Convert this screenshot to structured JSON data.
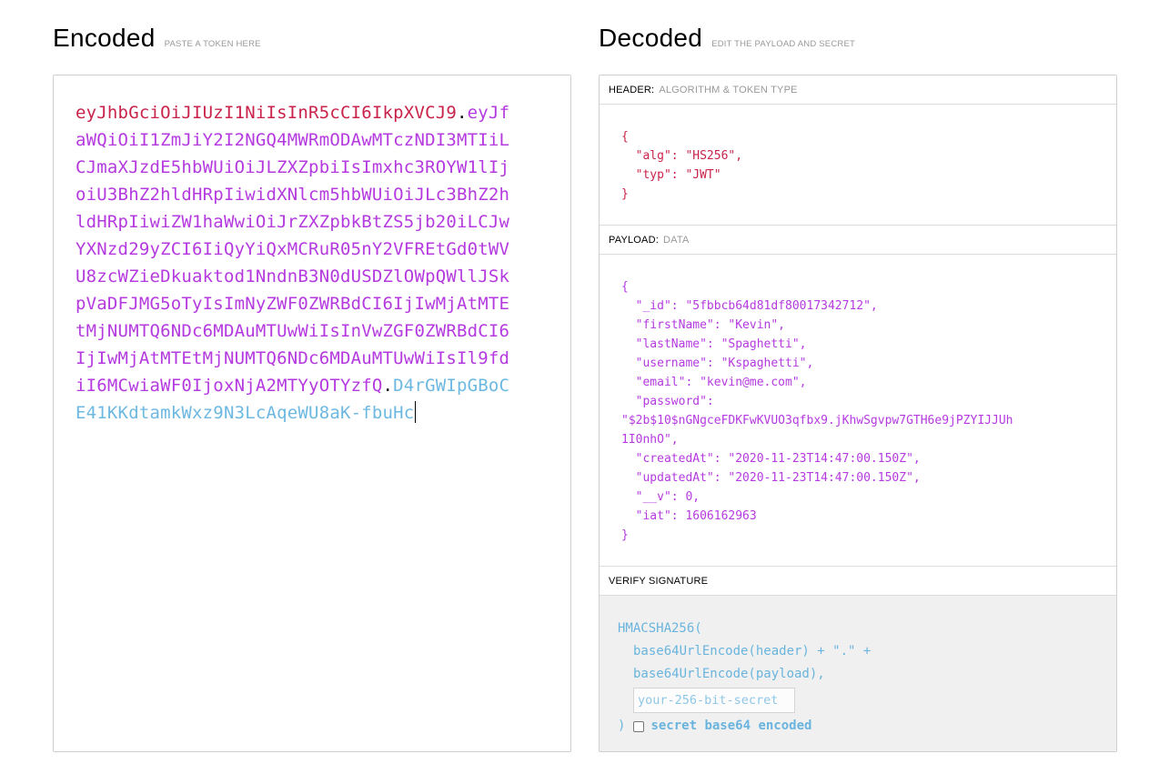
{
  "encoded": {
    "title": "Encoded",
    "subtitle": "PASTE A TOKEN HERE",
    "token_header": "eyJhbGciOiJIUzI1NiIsInR5cCI6IkpXVCJ9",
    "token_payload": "eyJfaWQiOiI1ZmJiY2I2NGQ4MWRmODAwMTczNDI3MTIiLCJmaXJzdE5hbWUiOiJLZXZpbiIsImxhc3ROYW1lIjoiU3BhZ2hldHRpIiwidXNlcm5hbWUiOiJLc3BhZ2hldHRpIiwiZW1haWwiOiJrZXZpbkBtZS5jb20iLCJwYXNzd29yZCI6IiQyYiQxMCRuR05nY2VFREtGd0tWVU8zcWZieDkuaktod1NndnB3N0dUSDZlOWpQWllJSkpVaDFJMG5oTyIsImNyZWF0ZWRBdCI6IjIwMjAtMTEtMjNUMTQ6NDc6MDAuMTUwWiIsInVwZGF0ZWRBdCI6IjIwMjAtMTEtMjNUMTQ6NDc6MDAuMTUwWiIsIl9fdiI6MCwiaWF0IjoxNjA2MTYyOTYzfQ",
    "token_signature": "D4rGWIpGBoCE41KKdtamkWxz9N3LcAqeWU8aK-fbuHc",
    "dot": "."
  },
  "decoded": {
    "title": "Decoded",
    "subtitle": "EDIT THE PAYLOAD AND SECRET",
    "header_section": {
      "label": "HEADER:",
      "hint": "ALGORITHM & TOKEN TYPE",
      "lines": [
        "{",
        "  \"alg\": \"HS256\",",
        "  \"typ\": \"JWT\"",
        "}"
      ]
    },
    "payload_section": {
      "label": "PAYLOAD:",
      "hint": "DATA",
      "lines": [
        "{",
        "  \"_id\": \"5fbbcb64d81df80017342712\",",
        "  \"firstName\": \"Kevin\",",
        "  \"lastName\": \"Spaghetti\",",
        "  \"username\": \"Kspaghetti\",",
        "  \"email\": \"kevin@me.com\",",
        "  \"password\":",
        "\"$2b$10$nGNgceFDKFwKVUO3qfbx9.jKhwSgvpw7GTH6e9jPZYIJJUh",
        "1I0nhO\",",
        "  \"createdAt\": \"2020-11-23T14:47:00.150Z\",",
        "  \"updatedAt\": \"2020-11-23T14:47:00.150Z\",",
        "  \"__v\": 0,",
        "  \"iat\": 1606162963",
        "}"
      ]
    },
    "verify_section": {
      "label": "VERIFY SIGNATURE",
      "fn_open": "HMACSHA256(",
      "arg1": "base64UrlEncode(header) + \".\" +",
      "arg2": "base64UrlEncode(payload),",
      "secret_placeholder": "your-256-bit-secret",
      "fn_close": ")",
      "b64_label": "secret base64 encoded"
    }
  },
  "colors": {
    "header": "#c9234b",
    "payload": "#b43adf",
    "signature": "#3da1d8"
  }
}
